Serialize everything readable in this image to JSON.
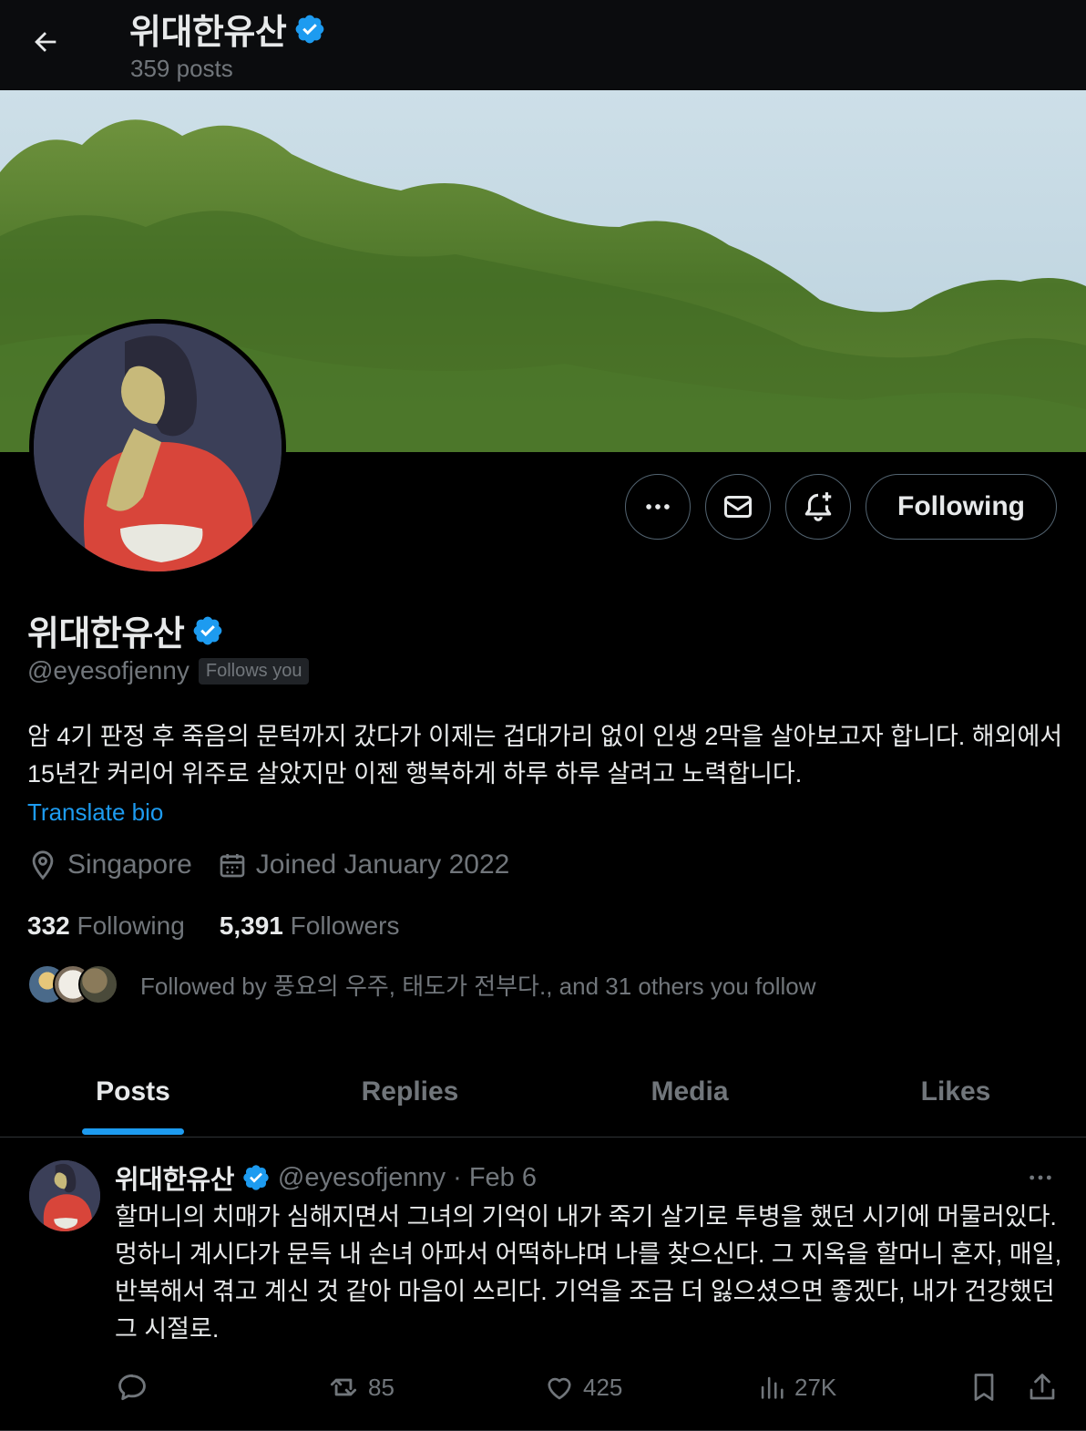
{
  "header": {
    "title": "위대한유산",
    "posts_count": "359 posts"
  },
  "profile": {
    "name": "위대한유산",
    "handle": "@eyesofjenny",
    "follows_you_badge": "Follows you",
    "bio": "암 4기 판정 후 죽음의 문턱까지 갔다가 이제는 겁대가리 없이 인생 2막을 살아보고자 합니다. 해외에서 15년간 커리어 위주로 살았지만 이젠 행복하게 하루 하루 살려고 노력합니다.",
    "translate_link": "Translate bio",
    "location": "Singapore",
    "joined": "Joined January 2022",
    "following_count": "332",
    "following_label": "Following",
    "followers_count": "5,391",
    "followers_label": "Followers",
    "followed_by": "Followed by 풍요의 우주, 태도가 전부다., and 31 others you follow"
  },
  "actions": {
    "follow_button": "Following",
    "icons": [
      "more-icon",
      "mail-icon",
      "notification-add-icon"
    ]
  },
  "tabs": [
    {
      "label": "Posts",
      "active": true
    },
    {
      "label": "Replies",
      "active": false
    },
    {
      "label": "Media",
      "active": false
    },
    {
      "label": "Likes",
      "active": false
    }
  ],
  "post": {
    "author": "위대한유산",
    "handle": "@eyesofjenny",
    "date": "· Feb 6",
    "text": "할머니의 치매가 심해지면서 그녀의 기억이 내가 죽기 살기로 투병을 했던 시기에 머물러있다. 멍하니 계시다가 문득 내 손녀 아파서 어떡하냐며 나를 찾으신다. 그 지옥을 할머니 혼자, 매일, 반복해서 겪고 계신 것 같아 마음이 쓰리다. 기억을 조금 더 잃으셨으면 좋겠다, 내가 건강했던 그 시절로.",
    "reposts": "85",
    "likes": "425",
    "views": "27K"
  },
  "colors": {
    "background": "#000000",
    "text_primary": "#e7e9ea",
    "text_secondary": "#71767b",
    "accent": "#1d9bf0",
    "verified": "#1d9bf0",
    "border": "#2f3336"
  }
}
